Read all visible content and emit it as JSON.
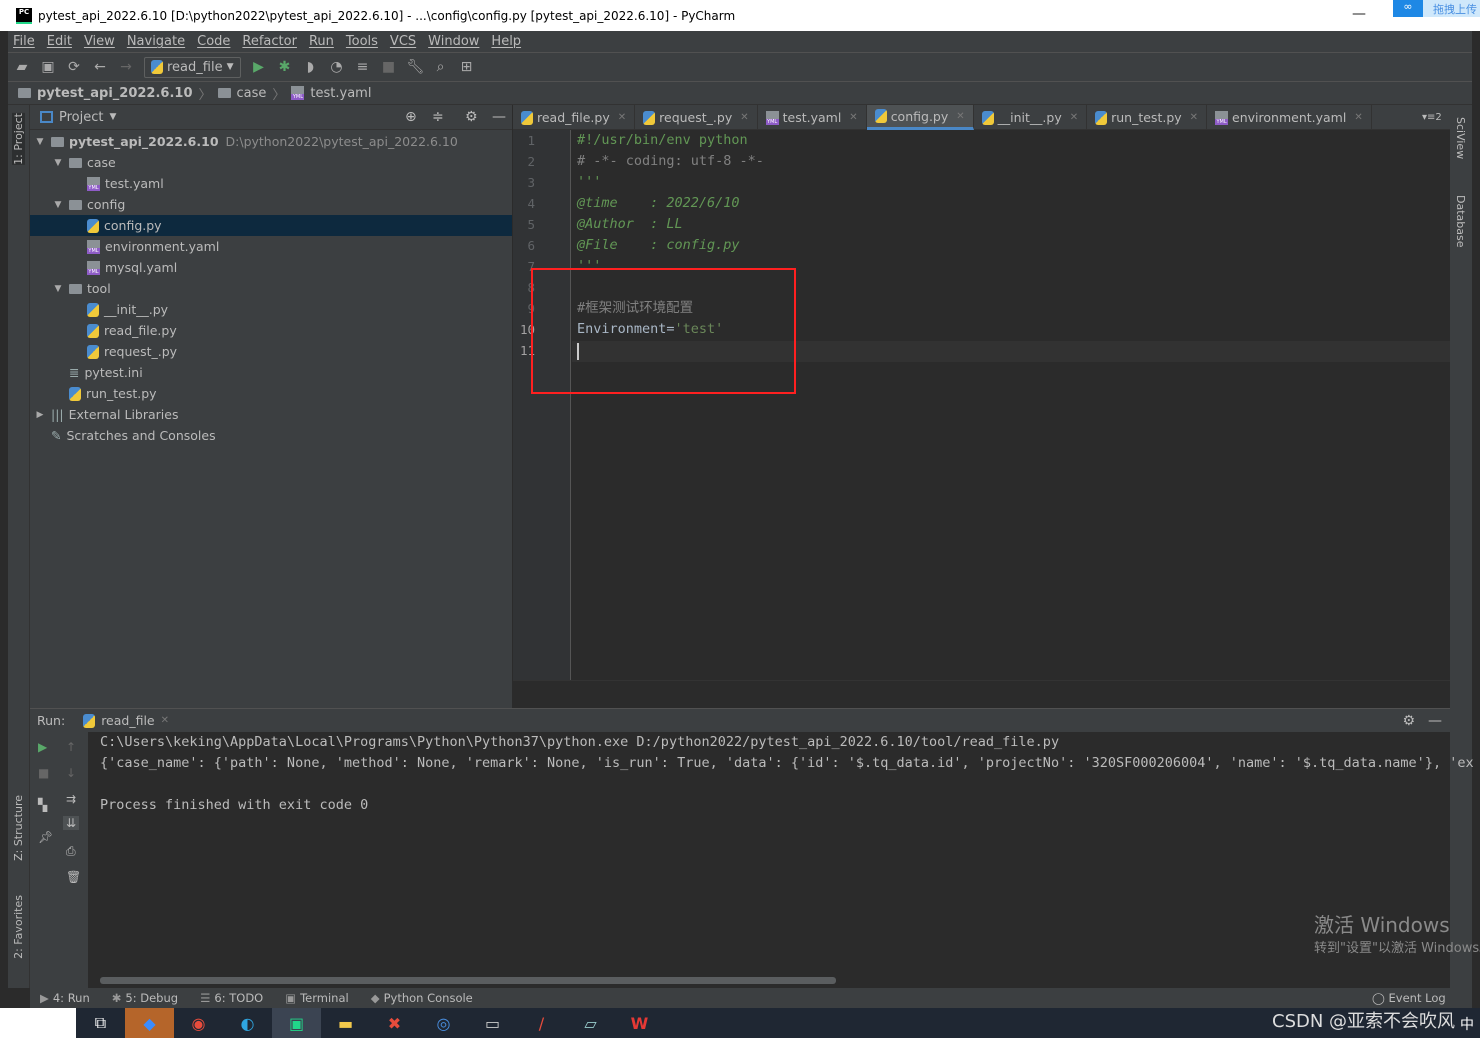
{
  "window": {
    "title": "pytest_api_2022.6.10 [D:\\python2022\\pytest_api_2022.6.10] - ...\\config\\config.py [pytest_api_2022.6.10] - PyCharm",
    "logo": "PC",
    "cloud_label": "拖拽上传"
  },
  "menu": [
    "File",
    "Edit",
    "View",
    "Navigate",
    "Code",
    "Refactor",
    "Run",
    "Tools",
    "VCS",
    "Window",
    "Help"
  ],
  "toolbar": {
    "run_config": "read_file"
  },
  "breadcrumb": [
    "pytest_api_2022.6.10",
    "case",
    "test.yaml"
  ],
  "left_strip": {
    "project": "1: Project",
    "structure": "Z: Structure",
    "favorites": "2: Favorites"
  },
  "right_strip": {
    "sciview": "SciView",
    "database": "Database"
  },
  "project": {
    "title": "Project",
    "items": [
      {
        "label": "pytest_api_2022.6.10",
        "path": "D:\\python2022\\pytest_api_2022.6.10",
        "icon": "folder",
        "level": 0,
        "arrow": "▼"
      },
      {
        "label": "case",
        "icon": "folder",
        "level": 1,
        "arrow": "▼"
      },
      {
        "label": "test.yaml",
        "icon": "yml",
        "level": 2,
        "arrow": ""
      },
      {
        "label": "config",
        "icon": "folder",
        "level": 1,
        "arrow": "▼"
      },
      {
        "label": "config.py",
        "icon": "py",
        "level": 2,
        "arrow": "",
        "selected": true
      },
      {
        "label": "environment.yaml",
        "icon": "yml",
        "level": 2,
        "arrow": ""
      },
      {
        "label": "mysql.yaml",
        "icon": "yml",
        "level": 2,
        "arrow": ""
      },
      {
        "label": "tool",
        "icon": "folder",
        "level": 1,
        "arrow": "▼"
      },
      {
        "label": "__init__.py",
        "icon": "py",
        "level": 2,
        "arrow": ""
      },
      {
        "label": "read_file.py",
        "icon": "py",
        "level": 2,
        "arrow": ""
      },
      {
        "label": "request_.py",
        "icon": "py",
        "level": 2,
        "arrow": ""
      },
      {
        "label": "pytest.ini",
        "icon": "ini",
        "level": 1,
        "arrow": ""
      },
      {
        "label": "run_test.py",
        "icon": "py",
        "level": 1,
        "arrow": ""
      },
      {
        "label": "External Libraries",
        "icon": "lib",
        "level": 0,
        "arrow": "▶"
      },
      {
        "label": "Scratches and Consoles",
        "icon": "scratch",
        "level": 0,
        "arrow": ""
      }
    ]
  },
  "tabs": [
    {
      "label": "read_file.py",
      "icon": "py"
    },
    {
      "label": "request_.py",
      "icon": "py"
    },
    {
      "label": "test.yaml",
      "icon": "yml"
    },
    {
      "label": "config.py",
      "icon": "py",
      "active": true
    },
    {
      "label": "__init__.py",
      "icon": "py"
    },
    {
      "label": "run_test.py",
      "icon": "py"
    },
    {
      "label": "environment.yaml",
      "icon": "yml"
    }
  ],
  "tabs_overflow": "2",
  "editor": {
    "lines": [
      {
        "n": "1",
        "text": "#!/usr/bin/env python",
        "color": "#629755"
      },
      {
        "n": "2",
        "text": "# -*- coding: utf-8 -*-",
        "color": "#808080"
      },
      {
        "n": "3",
        "text": "'''",
        "color": "#629755"
      },
      {
        "n": "4",
        "text": "@time    : 2022/6/10",
        "color": "#629755",
        "italic": true
      },
      {
        "n": "5",
        "text": "@Author  : LL",
        "color": "#629755",
        "italic": true
      },
      {
        "n": "6",
        "text": "@File    : config.py",
        "color": "#629755",
        "italic": true
      },
      {
        "n": "7",
        "text": "'''",
        "color": "#629755"
      },
      {
        "n": "8",
        "text": "",
        "color": "#a9b7c6"
      },
      {
        "n": "9",
        "text": "#框架测试环境配置",
        "color": "#808080"
      },
      {
        "n": "10",
        "text": "Environment=",
        "string": "'test'",
        "color": "#a9b7c6"
      },
      {
        "n": "11",
        "text": "",
        "color": "#a9b7c6"
      }
    ]
  },
  "run": {
    "label": "Run:",
    "tab": "read_file",
    "output": [
      "C:\\Users\\keking\\AppData\\Local\\Programs\\Python\\Python37\\python.exe D:/python2022/pytest_api_2022.6.10/tool/read_file.py",
      "{'case_name': {'path': None, 'method': None, 'remark': None, 'is_run': True, 'data': {'id': '$.tq_data.id', 'projectNo': '320SF000206004', 'name': '$.tq_data.name'}, 'ex",
      "",
      "Process finished with exit code 0"
    ]
  },
  "bottom_tools": [
    "4: Run",
    "5: Debug",
    "6: TODO",
    "Terminal",
    "Python Console"
  ],
  "event_log": "Event Log",
  "watermark": {
    "line1": "激活 Windows",
    "line2": "转到\"设置\"以激活 Windows。"
  },
  "csdn": "CSDN @亚索不会吹风",
  "ime": "中",
  "colors": {
    "accent": "#4a88c7",
    "highlight_box": "#ff2020",
    "selection": "#0d293e"
  }
}
